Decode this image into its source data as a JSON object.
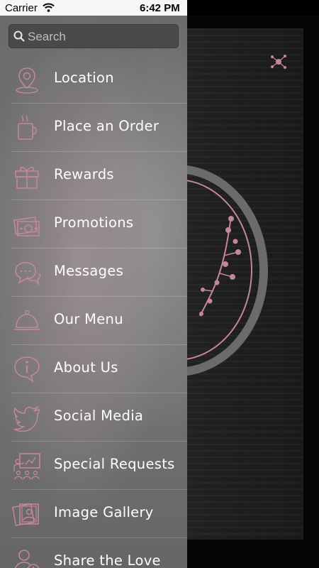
{
  "status_bar": {
    "carrier": "Carrier",
    "time": "6:42 PM"
  },
  "search": {
    "placeholder": "Search"
  },
  "menu": {
    "items": [
      {
        "label": "Location",
        "icon": "location-pin-icon"
      },
      {
        "label": "Place an Order",
        "icon": "coffee-cup-icon"
      },
      {
        "label": "Rewards",
        "icon": "gift-icon"
      },
      {
        "label": "Promotions",
        "icon": "money-icon"
      },
      {
        "label": "Messages",
        "icon": "chat-bubbles-icon"
      },
      {
        "label": "Our Menu",
        "icon": "cloche-icon"
      },
      {
        "label": "About Us",
        "icon": "info-icon"
      },
      {
        "label": "Social Media",
        "icon": "twitter-icon"
      },
      {
        "label": "Special Requests",
        "icon": "presentation-icon"
      },
      {
        "label": "Image Gallery",
        "icon": "photo-gallery-icon"
      },
      {
        "label": "Share the Love",
        "icon": "add-user-icon"
      }
    ]
  },
  "colors": {
    "icon_accent": "#c4869f",
    "drawer_bg": "#6f6f6f",
    "status_bg": "#f6f6f6"
  }
}
